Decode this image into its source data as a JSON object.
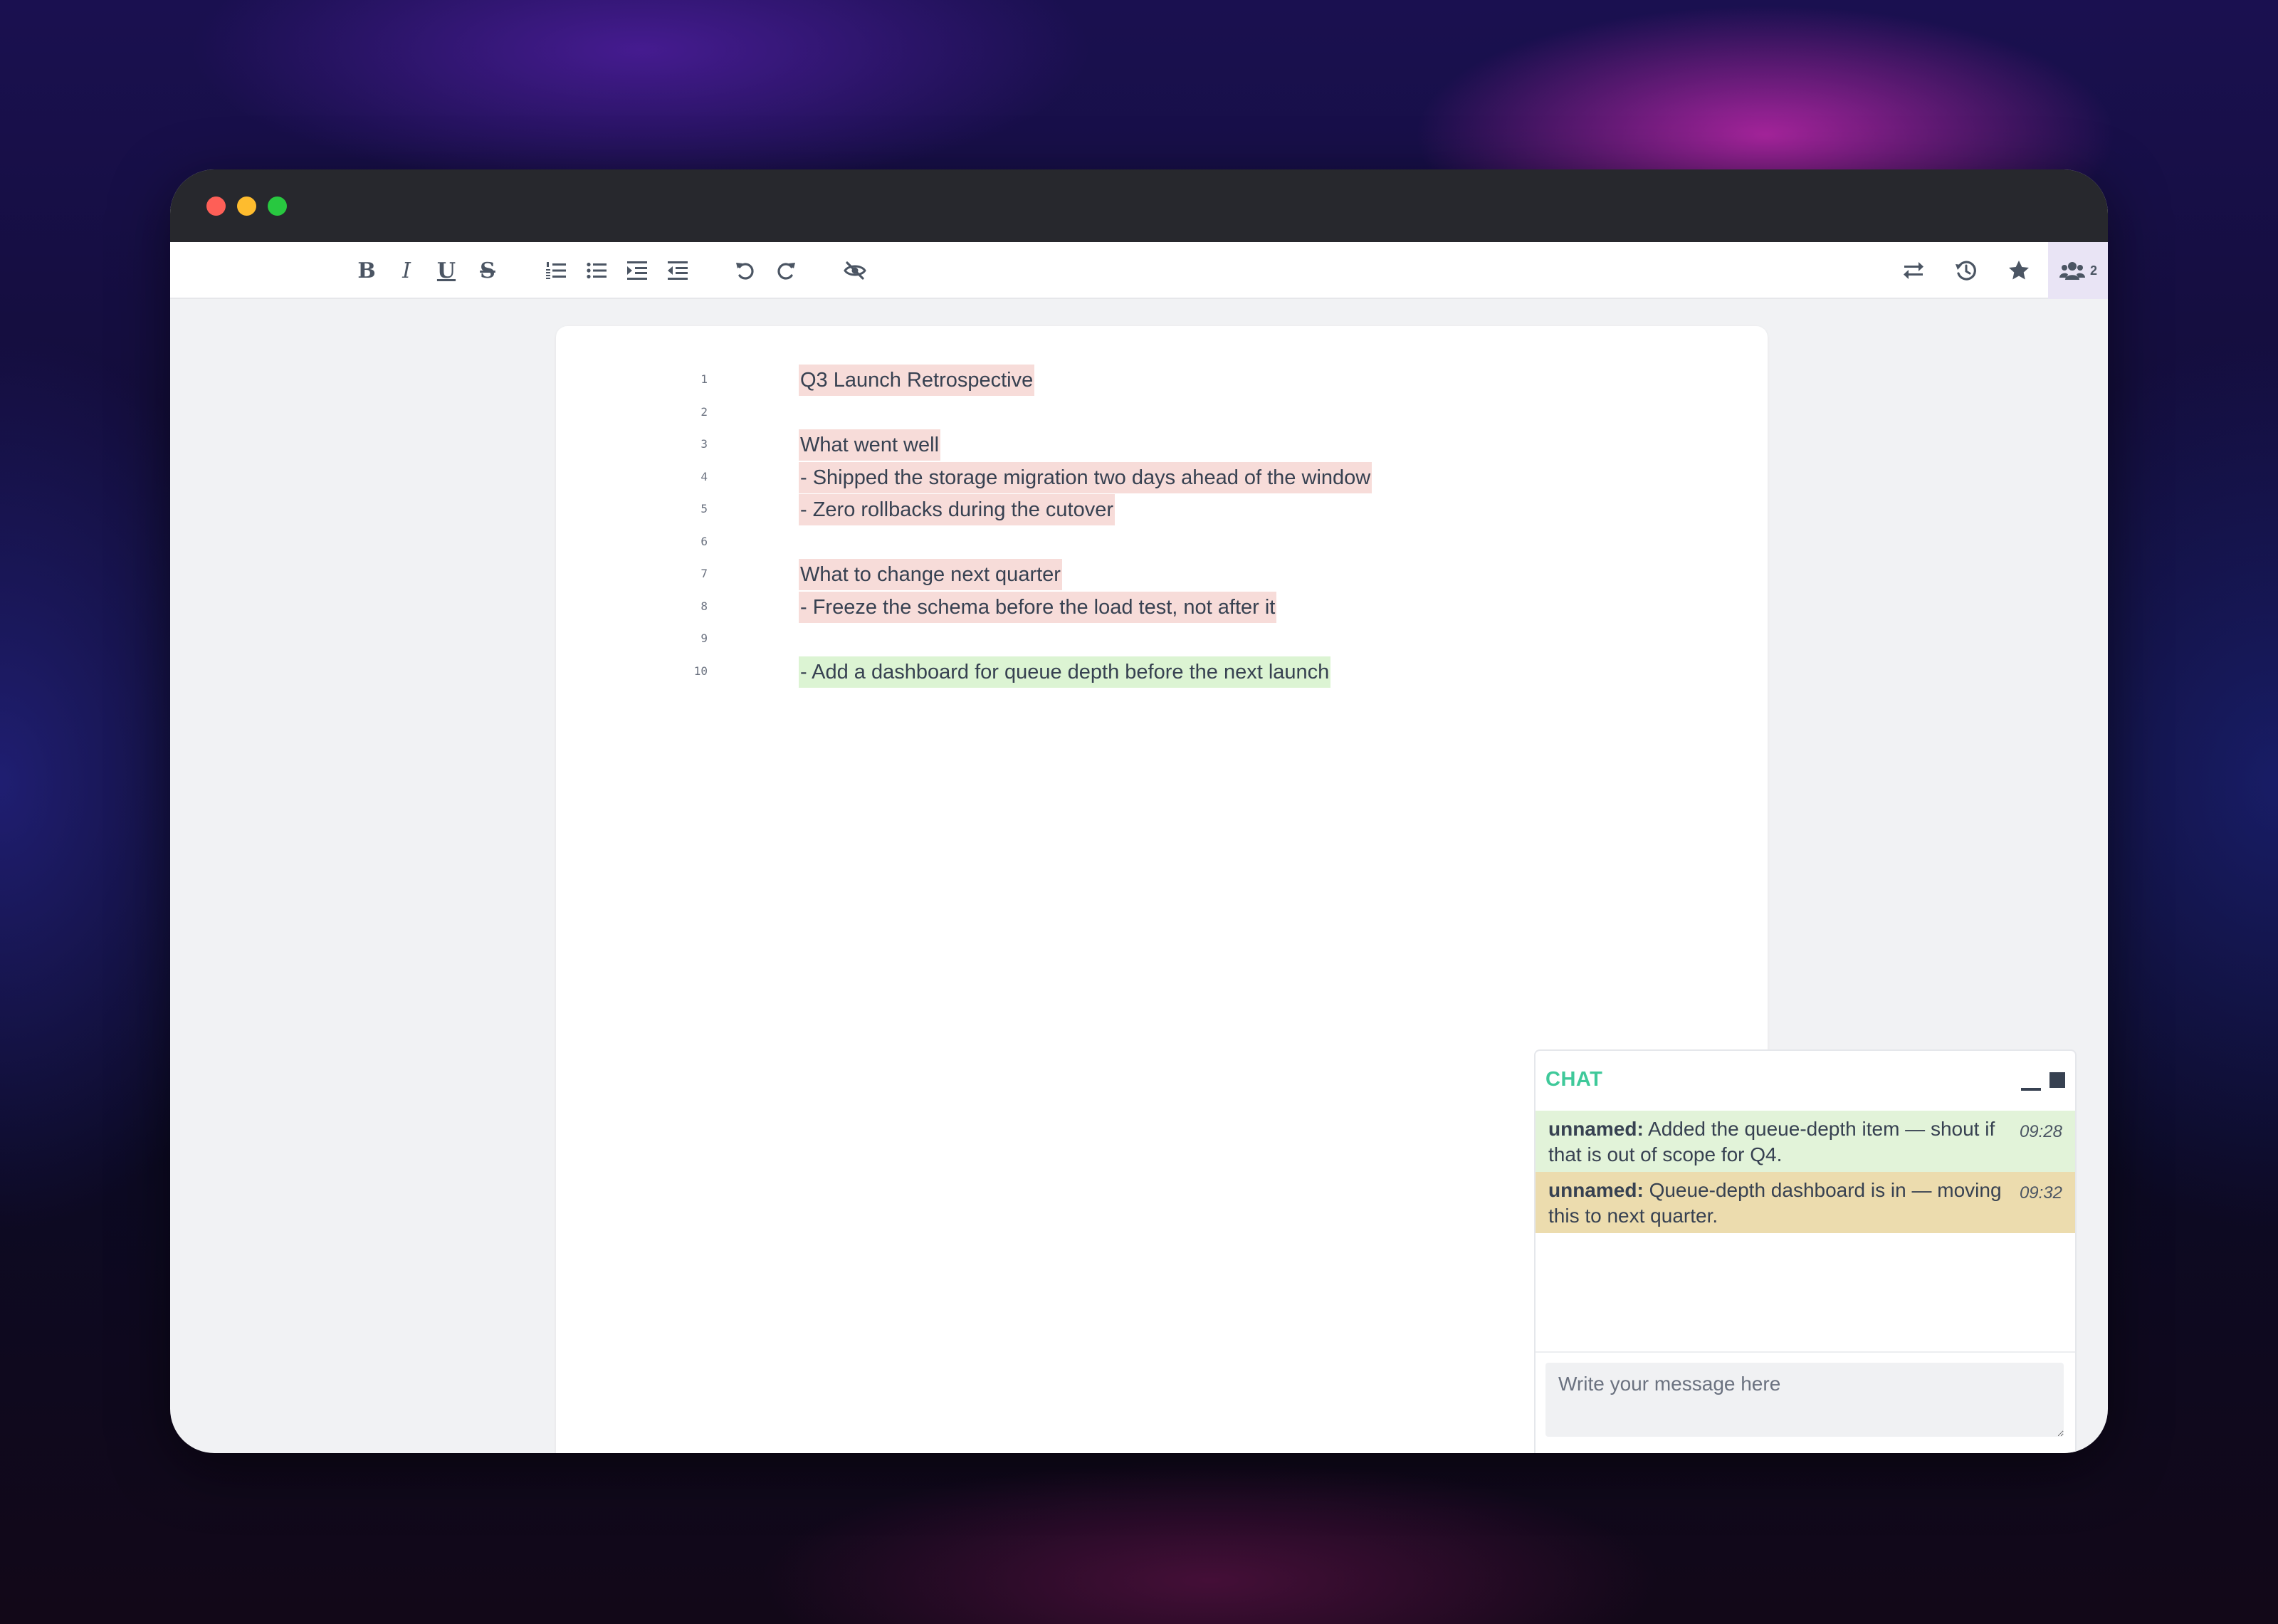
{
  "toolbar": {
    "bold_label": "B",
    "italic_label": "I",
    "underline_label": "U",
    "strike_label": "S",
    "left_icons": [
      "ordered-list-icon",
      "unordered-list-icon",
      "indent-icon",
      "outdent-icon",
      "undo-icon",
      "redo-icon",
      "hide-icon"
    ],
    "right_icons": [
      "swap-icon",
      "history-icon",
      "star-icon",
      "gear-icon",
      "share-icon",
      "home-icon"
    ],
    "users_count": "2"
  },
  "editor": {
    "lines": [
      {
        "number": "1",
        "text": "Q3 Launch Retrospective",
        "highlight": "red"
      },
      {
        "number": "2",
        "text": "",
        "highlight": "none"
      },
      {
        "number": "3",
        "text": "What went well",
        "highlight": "red"
      },
      {
        "number": "4",
        "text": "- Shipped the storage migration two days ahead of the window",
        "highlight": "red"
      },
      {
        "number": "5",
        "text": "- Zero rollbacks during the cutover",
        "highlight": "red"
      },
      {
        "number": "6",
        "text": "",
        "highlight": "none"
      },
      {
        "number": "7",
        "text": "What to change next quarter",
        "highlight": "red"
      },
      {
        "number": "8",
        "text": "- Freeze the schema before the load test, not after it",
        "highlight": "red"
      },
      {
        "number": "9",
        "text": "",
        "highlight": "none"
      },
      {
        "number": "10",
        "text": "- Add a dashboard for queue depth before the next launch",
        "highlight": "green"
      }
    ]
  },
  "chat": {
    "title": "CHAT",
    "messages": [
      {
        "author": "unnamed:",
        "text": "Added the queue-depth item — shout if that is out of scope for Q4.",
        "time": "09:28"
      },
      {
        "author": "unnamed:",
        "text": "Queue-depth dashboard is in — moving this to next quarter.",
        "time": "09:32"
      }
    ],
    "input_placeholder": "Write your message here"
  },
  "colors": {
    "author_highlight_red": "#f7dcd9",
    "author_highlight_green": "#dcf4d3",
    "chat_accent": "#3fc99a"
  }
}
